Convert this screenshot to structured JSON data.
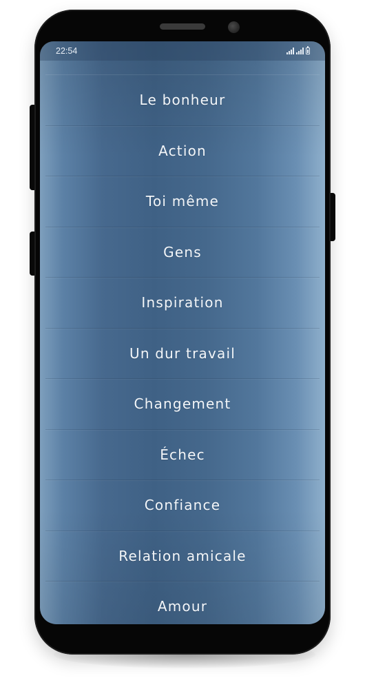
{
  "status_bar": {
    "time": "22:54",
    "icons": [
      "signal-icon",
      "signal-icon",
      "battery-icon"
    ]
  },
  "categories": [
    {
      "label": "Le bonheur"
    },
    {
      "label": "Action"
    },
    {
      "label": "Toi même"
    },
    {
      "label": "Gens"
    },
    {
      "label": "Inspiration"
    },
    {
      "label": "Un dur travail"
    },
    {
      "label": "Changement"
    },
    {
      "label": "Échec"
    },
    {
      "label": "Confiance"
    },
    {
      "label": "Relation amicale"
    },
    {
      "label": "Amour"
    }
  ],
  "colors": {
    "background_blue": "#45688c",
    "text": "#f3f6f9"
  }
}
